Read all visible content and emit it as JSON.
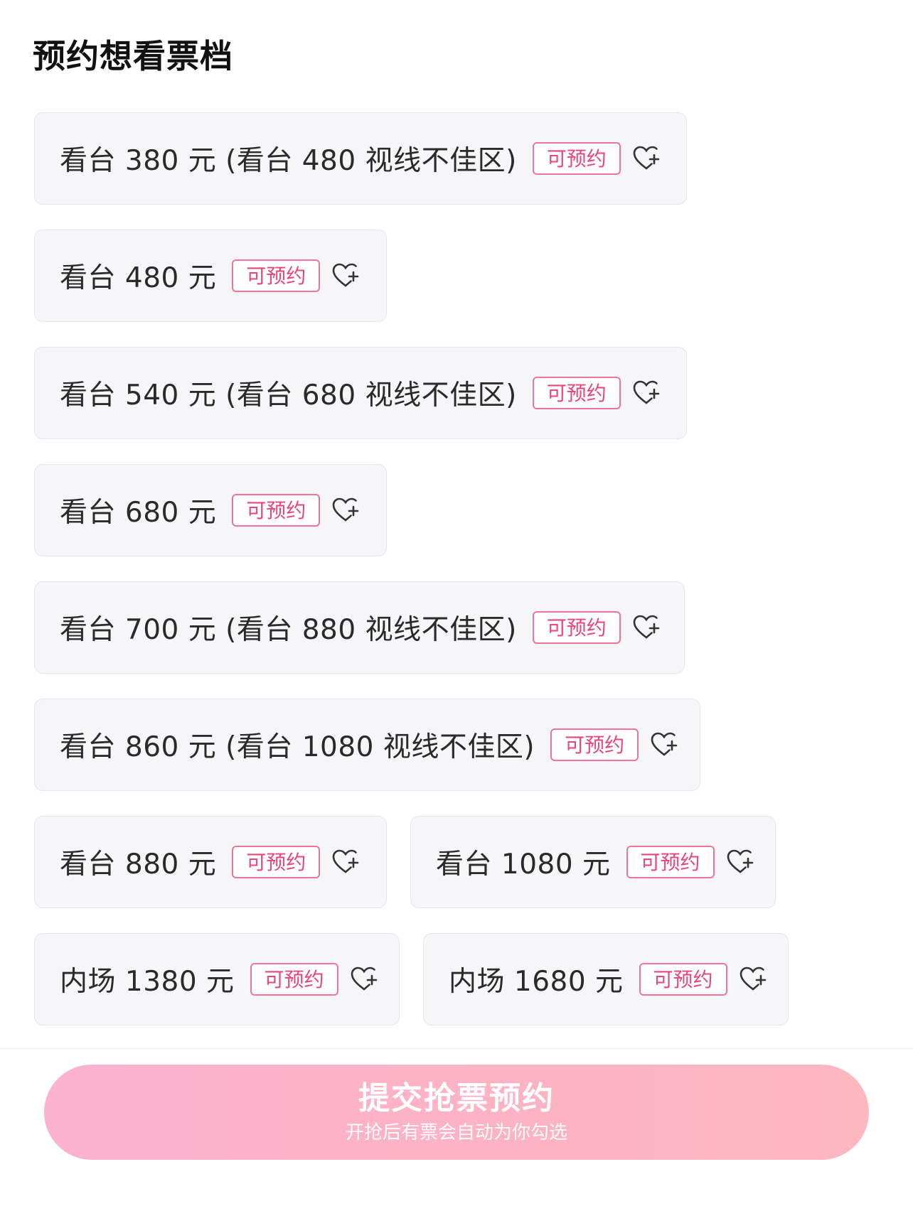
{
  "header": {
    "title": "预约想看票档"
  },
  "tiers": [
    {
      "label": "看台 380 元 (看台 480 视线不佳区)",
      "badge": "可预约",
      "icon": "heart-plus-icon"
    },
    {
      "label": "看台 480 元",
      "badge": "可预约",
      "icon": "heart-plus-icon"
    },
    {
      "label": "看台 540 元 (看台 680 视线不佳区)",
      "badge": "可预约",
      "icon": "heart-plus-icon"
    },
    {
      "label": "看台 680 元",
      "badge": "可预约",
      "icon": "heart-plus-icon"
    },
    {
      "label": "看台 700 元 (看台 880 视线不佳区)",
      "badge": "可预约",
      "icon": "heart-plus-icon"
    },
    {
      "label": "看台 860 元 (看台 1080 视线不佳区)",
      "badge": "可预约",
      "icon": "heart-plus-icon"
    },
    {
      "label": "看台 880 元",
      "badge": "可预约",
      "icon": "heart-plus-icon"
    },
    {
      "label": "看台 1080 元",
      "badge": "可预约",
      "icon": "heart-plus-icon"
    },
    {
      "label": "内场 1380 元",
      "badge": "可预约",
      "icon": "heart-plus-icon"
    },
    {
      "label": "内场 1680 元",
      "badge": "可预约",
      "icon": "heart-plus-icon"
    }
  ],
  "submit": {
    "label": "提交抢票预约",
    "sublabel": "开抢后有票会自动为你勾选"
  },
  "colors": {
    "accent": "#e9457b",
    "button_gradient_start": "#fbb2cf",
    "button_gradient_end": "#fdb7bf"
  }
}
